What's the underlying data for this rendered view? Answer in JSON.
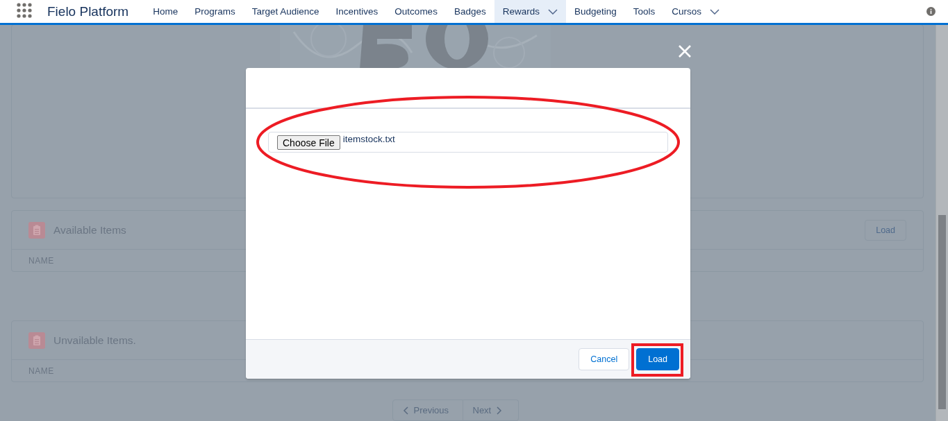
{
  "nav": {
    "app_name": "Fielo Platform",
    "items": [
      {
        "label": "Home",
        "selected": false,
        "has_menu": false
      },
      {
        "label": "Programs",
        "selected": false,
        "has_menu": false
      },
      {
        "label": "Target Audience",
        "selected": false,
        "has_menu": false
      },
      {
        "label": "Incentives",
        "selected": false,
        "has_menu": false
      },
      {
        "label": "Outcomes",
        "selected": false,
        "has_menu": false
      },
      {
        "label": "Badges",
        "selected": false,
        "has_menu": false
      },
      {
        "label": "Rewards",
        "selected": true,
        "has_menu": true
      },
      {
        "label": "Budgeting",
        "selected": false,
        "has_menu": false
      },
      {
        "label": "Tools",
        "selected": false,
        "has_menu": false
      },
      {
        "label": "Cursos",
        "selected": false,
        "has_menu": true
      }
    ]
  },
  "page": {
    "cards": [
      {
        "title": "Available Items",
        "action": "Load",
        "columns": [
          "NAME"
        ]
      },
      {
        "title": "Unvailable Items.",
        "columns": [
          "NAME"
        ]
      }
    ],
    "pagination": [
      {
        "label": "Previous",
        "disabled": true,
        "kind": "prev"
      },
      {
        "label": "Next",
        "disabled": true,
        "kind": "next"
      }
    ]
  },
  "modal": {
    "file_input": {
      "button": "Choose File",
      "file_name": "itemstock.txt"
    },
    "buttons": [
      {
        "label": "Cancel",
        "kind": "neutral"
      },
      {
        "label": "Load",
        "kind": "brand"
      }
    ],
    "annotations": [
      {
        "kind": "ellipse",
        "color": "#ed1c24"
      },
      {
        "kind": "rectangle",
        "color": "#ed1c24"
      }
    ]
  }
}
